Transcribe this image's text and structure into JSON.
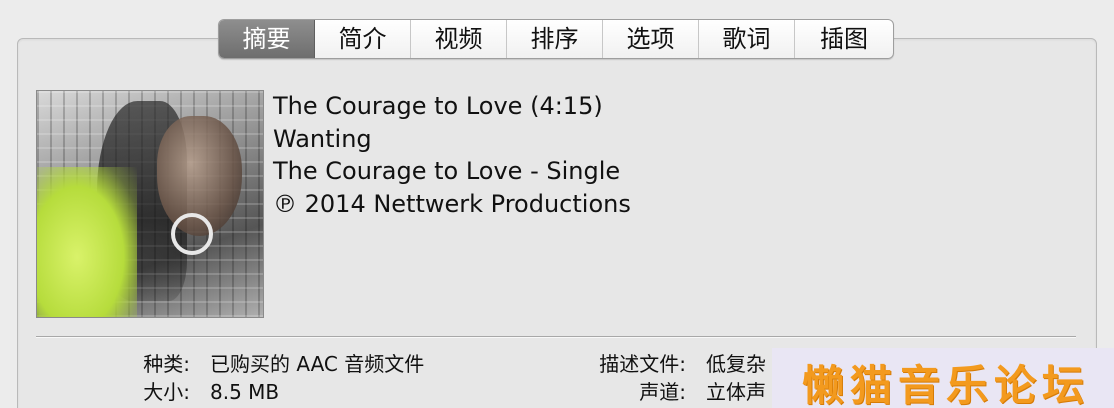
{
  "tabs": [
    {
      "label": "摘要",
      "active": true
    },
    {
      "label": "简介",
      "active": false
    },
    {
      "label": "视频",
      "active": false
    },
    {
      "label": "排序",
      "active": false
    },
    {
      "label": "选项",
      "active": false
    },
    {
      "label": "歌词",
      "active": false
    },
    {
      "label": "插图",
      "active": false
    }
  ],
  "track": {
    "title_line": "The Courage to Love (4:15)",
    "artist": "Wanting",
    "album": "The Courage to Love - Single",
    "copyright": "℗ 2014 Nettwerk Productions"
  },
  "info_left": [
    {
      "label": "种类:",
      "value": "已购买的 AAC 音频文件"
    },
    {
      "label": "大小:",
      "value": "8.5 MB"
    }
  ],
  "info_right": [
    {
      "label": "描述文件:",
      "value": "低复杂"
    },
    {
      "label": "声道:",
      "value": "立体声"
    }
  ],
  "watermark": {
    "text": "懒猫音乐论坛"
  },
  "colors": {
    "background": "#ececec",
    "active_tab": "#7a7a7a",
    "watermark_text": "#f39a1e",
    "watermark_bg": "#e9e6f4"
  }
}
